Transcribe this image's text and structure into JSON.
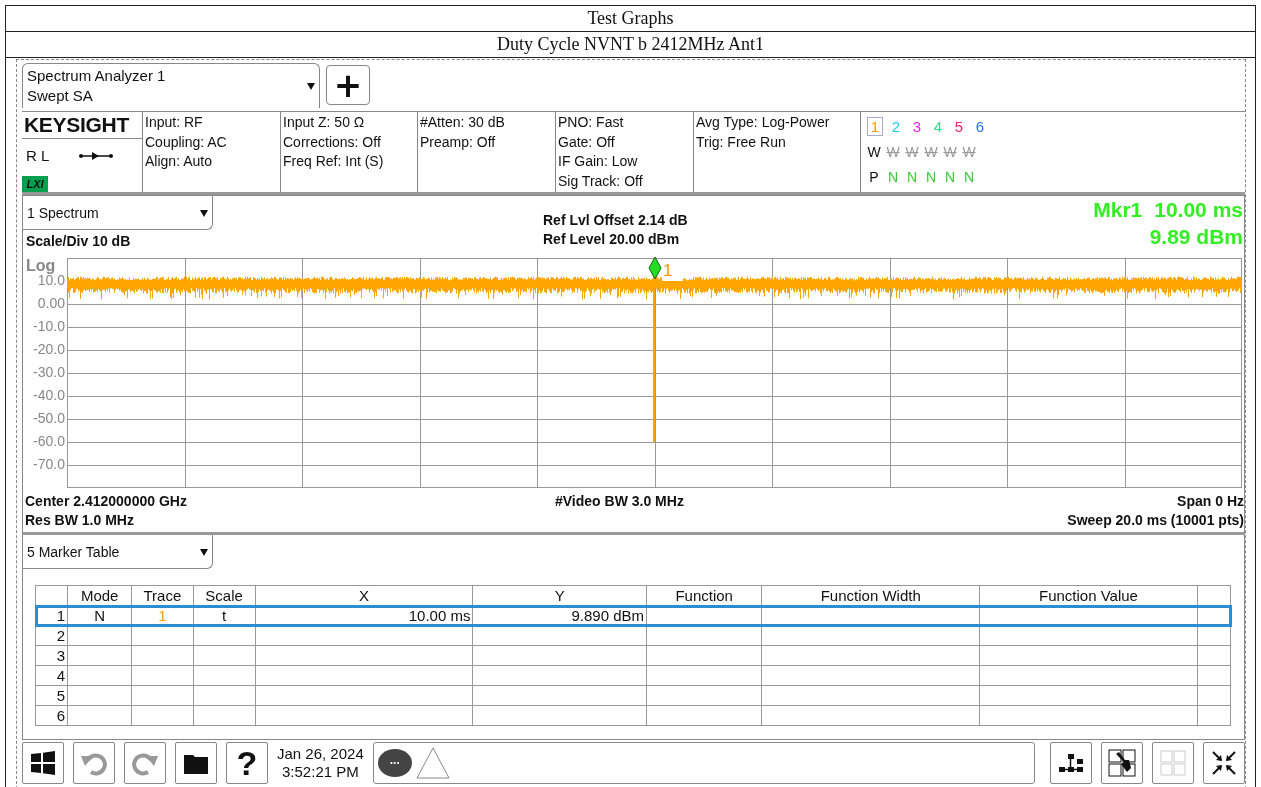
{
  "page": {
    "title": "Test Graphs",
    "subtitle": "Duty Cycle NVNT b 2412MHz Ant1"
  },
  "analyzer": {
    "name": "Spectrum Analyzer 1",
    "mode": "Swept SA",
    "add_label": "+"
  },
  "status": {
    "brand": "KEYSIGHT",
    "rl": "R L",
    "lxi": "LXI",
    "groups": [
      [
        "Input: RF",
        "Coupling: AC",
        "Align: Auto"
      ],
      [
        "Input Z: 50 Ω",
        "Corrections: Off",
        "Freq Ref: Int (S)"
      ],
      [
        "#Atten: 30 dB",
        "Preamp: Off"
      ],
      [
        "PNO: Fast",
        "Gate: Off",
        "IF Gain: Low",
        "Sig Track: Off"
      ],
      [
        "Avg Type: Log-Power",
        "Trig: Free Run"
      ]
    ]
  },
  "traces": [
    {
      "label": "1",
      "color": "#ff9900",
      "selected": true,
      "type": "W",
      "type_on": true
    },
    {
      "label": "2",
      "color": "#22ccee",
      "selected": false,
      "type": "W",
      "type_on": false
    },
    {
      "label": "3",
      "color": "#ee22ee",
      "selected": false,
      "type": "W",
      "type_on": false
    },
    {
      "label": "4",
      "color": "#22dd88",
      "selected": false,
      "type": "W",
      "type_on": false
    },
    {
      "label": "5",
      "color": "#ee2266",
      "selected": false,
      "type": "W",
      "type_on": false
    },
    {
      "label": "6",
      "color": "#2277ee",
      "selected": false,
      "type": "W",
      "type_on": false
    }
  ],
  "detectors": [
    {
      "label": "P",
      "color": "#111111"
    },
    {
      "label": "N",
      "color": "#33cc33"
    },
    {
      "label": "N",
      "color": "#33cc33"
    },
    {
      "label": "N",
      "color": "#33cc33"
    },
    {
      "label": "N",
      "color": "#33cc33"
    },
    {
      "label": "N",
      "color": "#33cc33"
    }
  ],
  "spectrum": {
    "window": "1 Spectrum",
    "scale": "Scale/Div 10 dB",
    "scale_type": "Log",
    "ref_offset": "Ref Lvl Offset 2.14 dB",
    "ref_level": "Ref Level 20.00 dBm",
    "marker_name": "Mkr1",
    "marker_x": "10.00 ms",
    "marker_y": "9.89 dBm",
    "y_labels": [
      "10.0",
      "0.00",
      "-10.0",
      "-20.0",
      "-30.0",
      "-40.0",
      "-50.0",
      "-60.0",
      "-70.0"
    ],
    "marker_label": "1",
    "center": "Center 2.412000000 GHz",
    "res_bw": "Res BW 1.0 MHz",
    "video_bw": "#Video BW 3.0 MHz",
    "span": "Span 0 Hz",
    "sweep": "Sweep 20.0 ms (10001 pts)"
  },
  "marker_table": {
    "window": "5 Marker Table",
    "columns": [
      "Mode",
      "Trace",
      "Scale",
      "X",
      "Y",
      "Function",
      "Function Width",
      "Function Value"
    ],
    "rows": [
      {
        "index": "1",
        "mode": "N",
        "trace": "1",
        "color": "#ff9900",
        "scale": "t",
        "x": "10.00 ms",
        "y": "9.890 dBm",
        "selected": true
      },
      {
        "index": "2",
        "selected": false
      },
      {
        "index": "3",
        "selected": false
      },
      {
        "index": "4",
        "selected": false
      },
      {
        "index": "5",
        "selected": false
      },
      {
        "index": "6",
        "selected": false
      }
    ]
  },
  "taskbar": {
    "help_label": "?",
    "date": "Jan 26, 2024",
    "time": "3:52:21 PM",
    "message_label": "...",
    "undo_disabled": true,
    "redo_disabled": true,
    "grid_disabled": true
  }
}
